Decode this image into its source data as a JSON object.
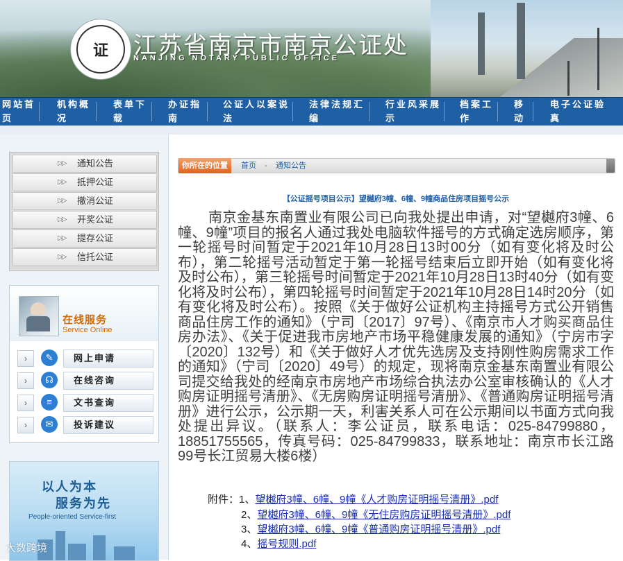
{
  "banner": {
    "office_name_cn": "江苏省南京市南京公证处",
    "office_name_en": "NANJING NOTARY PUBLIC OFFICE",
    "seal_text": "南京公证处"
  },
  "nav": [
    {
      "line1": "网站首",
      "line2": "页"
    },
    {
      "line1": "机构概",
      "line2": "况"
    },
    {
      "line1": "表单下",
      "line2": "载"
    },
    {
      "line1": "办证指",
      "line2": "南"
    },
    {
      "line1": "公证人以案说",
      "line2": "法"
    },
    {
      "line1": "法律法规汇",
      "line2": "编"
    },
    {
      "line1": "行业风采展",
      "line2": "示"
    },
    {
      "line1": "档案工",
      "line2": "作"
    },
    {
      "line1": "移",
      "line2": "动"
    },
    {
      "line1": "电子公证验",
      "line2": "真"
    }
  ],
  "sidebar": {
    "menu_arrow": "▷▷",
    "menu": [
      "通知公告",
      "抵押公证",
      "撤消公证",
      "开奖公证",
      "提存公证",
      "信托公证"
    ],
    "online": {
      "title_cn": "在线服务",
      "title_en": "Service Online"
    },
    "services": [
      {
        "label": "网上申请",
        "icon": "form-icon",
        "glyph": "✎"
      },
      {
        "label": "在线咨询",
        "icon": "headset-icon",
        "glyph": "☊"
      },
      {
        "label": "文书查询",
        "icon": "document-icon",
        "glyph": "≡"
      },
      {
        "label": "投诉建议",
        "icon": "chat-icon",
        "glyph": "✉"
      }
    ],
    "service_chevron": "›",
    "slogan": {
      "line1": "以人为本",
      "line2": "服务为先",
      "en": "People-oriented  Service-first"
    }
  },
  "breadcrumb": {
    "label": "你所在的位置",
    "home": "首页",
    "sep": "-",
    "current": "通知公告"
  },
  "article": {
    "title": "【公证摇号项目公示】望樾府3幢、6幢、9幢商品住房项目摇号公示",
    "body": "南京金基东南置业有限公司已向我处提出申请，对“望樾府3幢、6幢、9幢”项目的报名人通过我处电脑软件摇号的方式确定选房顺序，第一轮摇号时间暂定于2021年10月28日13时00分（如有变化将及时公布），第二轮摇号活动暂定于第一轮摇号结束后立即开始（如有变化将及时公布），第三轮摇号时间暂定于2021年10月28日13时40分（如有变化将及时公布），第四轮摇号时间暂定于2021年10月28日14时20分（如有变化将及时公布）。按照《关于做好公证机构主持摇号方式公开销售商品住房工作的通知》（宁司〔2017〕97号）、《南京市人才购买商品住房办法》、《关于促进我市房地产市场平稳健康发展的通知》（宁房市字〔2020〕132号）和《关于做好人才优先选房及支持刚性购房需求工作的通知》（宁司〔2020〕49号）的规定，现将南京金基东南置业有限公司提交给我处的经南京市房地产市场综合执法办公室审核确认的《人才购房证明摇号清册》、《无房购房证明摇号清册》、《普通购房证明摇号清册》进行公示，公示期一天，利害关系人可在公示期间以书面方式向我处提出异议。（联系人：李公证员，联系电话：025-84799880，18851755565，传真号码：025-84799833，联系地址：南京市长江路99号长江贸易大楼6楼）",
    "attachments_label": "附件：",
    "attachments": [
      {
        "num": "1、",
        "name": "望樾府3幢、6幢、9幢《人才购房证明摇号清册》.pdf"
      },
      {
        "num": "2、",
        "name": "望樾府3幢、6幢、9幢《无住房购房证明摇号清册》.pdf"
      },
      {
        "num": "3、",
        "name": "望樾府3幢、6幢、9幢《普通购房证明摇号清册》.pdf"
      },
      {
        "num": "4、",
        "name": "摇号规则.pdf"
      }
    ]
  },
  "watermark": "大数跨境"
}
